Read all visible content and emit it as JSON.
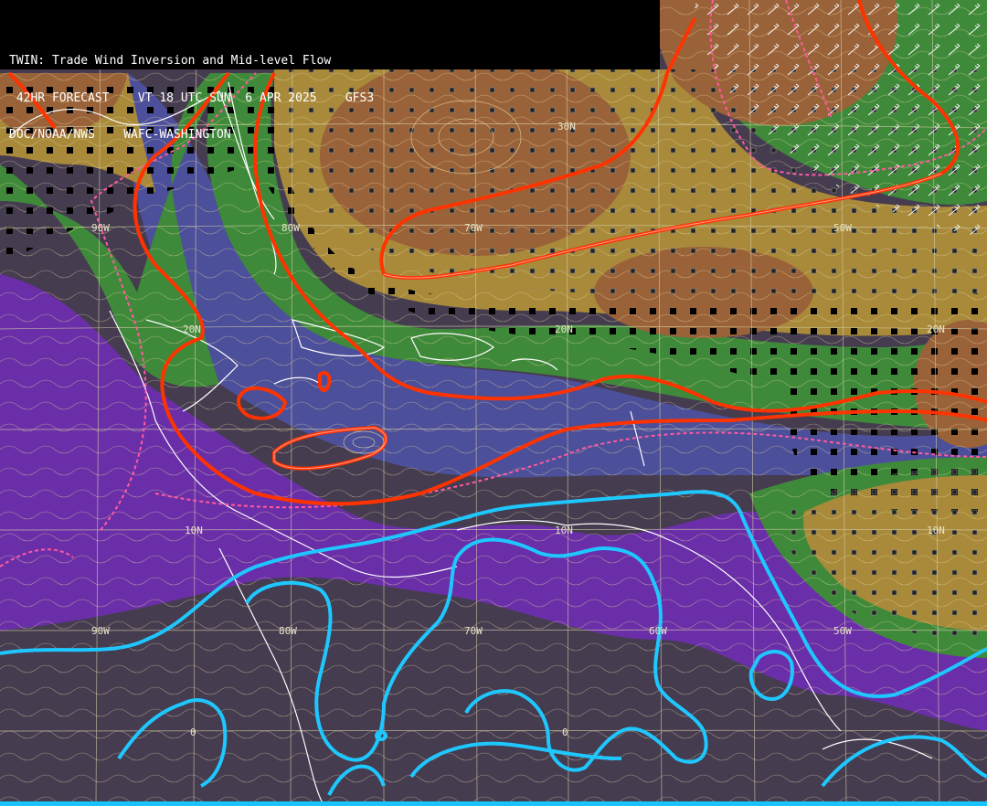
{
  "header": {
    "title": "TWIN: Trade Wind Inversion and Mid-level Flow",
    "line2": " 42HR FORECAST    VT 18 UTC SUN  6 APR 2025    GFS3",
    "line3": "DOC/NOAA/NWS    WAFC-WASHINGTON"
  },
  "grid_labels": {
    "lat_30n": "30N",
    "lat_20n_w": "20N",
    "lat_20n_c": "20N",
    "lat_20n_e": "20N",
    "lat_10n_w": "10N",
    "lat_10n_c": "10N",
    "lat_10n_e": "10N",
    "lat_0_w": "0",
    "lat_0_c": "0",
    "lon_90w_n": "90W",
    "lon_80w_n": "80W",
    "lon_70w_n": "70W",
    "lon_50w_n": "50W",
    "lon_90w_s": "90W",
    "lon_80w_s": "80W",
    "lon_70w_s": "70W",
    "lon_60w_s": "60W",
    "lon_50w_s": "50W"
  },
  "colors": {
    "deep": "#453c50",
    "purple": "#6a2fa8",
    "blue_purple": "#4c4f9a",
    "green": "#3f8a3a",
    "olive": "#a88a3a",
    "brown": "#9a6238",
    "contour_red": "#ff3300",
    "contour_pink": "#ff5aa0",
    "contour_cyan": "#1ec8ff",
    "streamline": "#e8d9a0"
  }
}
